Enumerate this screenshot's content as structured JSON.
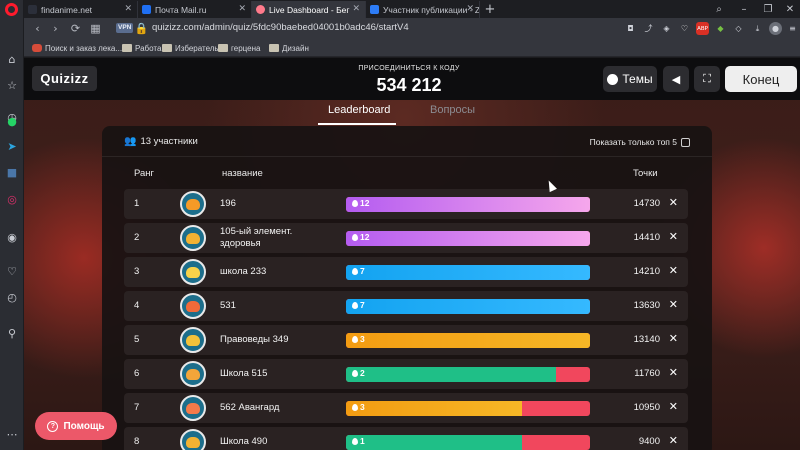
{
  "browser": {
    "tabs": [
      {
        "title": "findanime.net",
        "fav_color": "#2b2f3a"
      },
      {
        "title": "Почта Mail.ru",
        "fav_color": "#1f6ff2"
      },
      {
        "title": "Live Dashboard - Бег",
        "fav_color": "#ff7a8b"
      },
      {
        "title": "Участник публикации - Z",
        "fav_color": "#2d7cf6"
      }
    ],
    "active_tab": 2,
    "vpn": "VPN",
    "url": "quizizz.com/admin/quiz/5fdc90baebed04001b0adc46/startV4",
    "bookmarks": [
      "Поиск и заказ лека...",
      "Работа",
      "Избератель",
      "герцена",
      "Дизайн"
    ]
  },
  "header": {
    "logo": "Quizizz",
    "join_label": "ПРИСОЕДИНИТЬСЯ К КОДУ",
    "join_code": "534 212",
    "themes_label": "Темы",
    "end_label": "Конец"
  },
  "tabs": {
    "leaderboard": "Leaderboard",
    "questions": "Вопросы"
  },
  "panel": {
    "participants": "13 участники",
    "top5_label": "Показать только топ 5",
    "col_rank": "Ранг",
    "col_name": "название",
    "col_points": "Точки"
  },
  "rows": [
    {
      "rank": "1",
      "name": "196",
      "line2": "",
      "streak": "12",
      "fill": 1.0,
      "fill_color": "#b45cf0",
      "fill_color2": "#f6a7ec",
      "points": "14730",
      "av": "#f59a27"
    },
    {
      "rank": "2",
      "name": "105-ый элемент.",
      "line2": "здоровья",
      "streak": "12",
      "fill": 1.0,
      "fill_color": "#b45cf0",
      "fill_color2": "#f6a7ec",
      "points": "14410",
      "av": "#f2b233"
    },
    {
      "rank": "3",
      "name": "школа 233",
      "line2": "",
      "streak": "7",
      "fill": 1.0,
      "fill_color": "#13a3f0",
      "fill_color2": "#35b9ff",
      "points": "14210",
      "av": "#f7d24a"
    },
    {
      "rank": "4",
      "name": "531",
      "line2": "",
      "streak": "7",
      "fill": 1.0,
      "fill_color": "#13a3f0",
      "fill_color2": "#35b9ff",
      "points": "13630",
      "av": "#f06a3a"
    },
    {
      "rank": "5",
      "name": "Правоведы 349",
      "line2": "",
      "streak": "3",
      "fill": 1.0,
      "fill_color": "#f39c12",
      "fill_color2": "#f6b726",
      "points": "13140",
      "av": "#f3c23a"
    },
    {
      "rank": "6",
      "name": "Школа 515",
      "line2": "",
      "streak": "2",
      "fill": 0.86,
      "fill_color": "#1fbf87",
      "fill_color2": "#1fbf87",
      "points": "11760",
      "av": "#f2a53a"
    },
    {
      "rank": "7",
      "name": "562 Авангард",
      "line2": "",
      "streak": "3",
      "fill": 0.72,
      "fill_color": "#f39c12",
      "fill_color2": "#f6b726",
      "points": "10950",
      "av": "#f47a4a"
    },
    {
      "rank": "8",
      "name": "Школа 490",
      "line2": "",
      "streak": "1",
      "fill": 0.72,
      "fill_color": "#1fbf87",
      "fill_color2": "#1fbf87",
      "points": "9400",
      "av": "#f2b233"
    }
  ],
  "help_label": "Помощь",
  "colors": {
    "accent": "#ec5869",
    "bar_empty": "#f1475d",
    "header_bg": "#0d0d0f"
  }
}
